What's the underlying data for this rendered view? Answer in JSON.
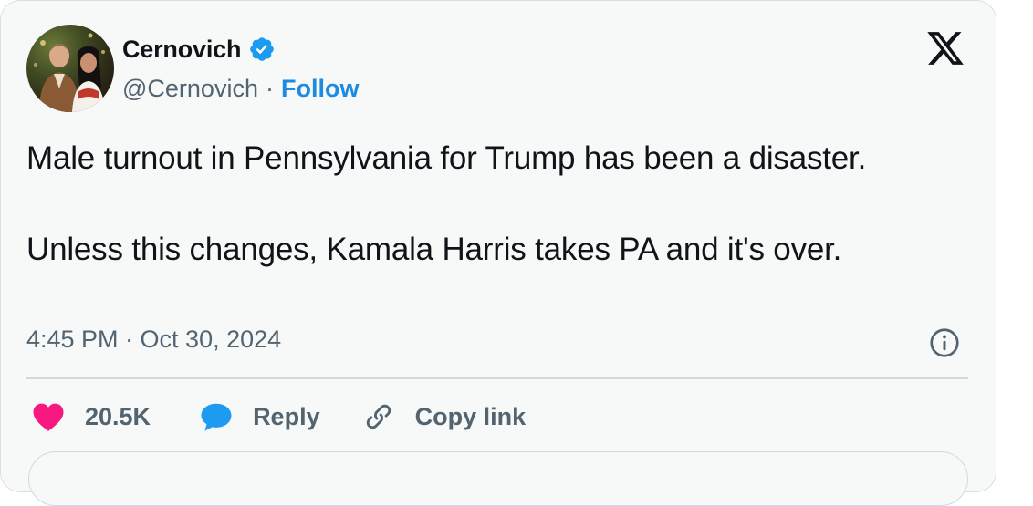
{
  "tweet": {
    "display_name": "Cernovich",
    "handle": "@Cernovich",
    "separator": "·",
    "follow_label": "Follow",
    "paragraphs": [
      "Male turnout in Pennsylvania for Trump has been a disaster.",
      "Unless this changes, Kamala Harris takes PA and it's over."
    ],
    "timestamp": "4:45 PM · Oct 30, 2024",
    "icons": {
      "brand": "x-logo-icon",
      "verified": "verified-badge-icon",
      "info": "info-icon",
      "like": "heart-icon",
      "reply": "speech-bubble-icon",
      "copy": "link-icon"
    }
  },
  "actions": {
    "like_count": "20.5K",
    "reply_label": "Reply",
    "copy_label": "Copy link"
  },
  "colors": {
    "accent": "#1d8be0",
    "like": "#f91880",
    "reply": "#1d9bf0",
    "text": "#0f1419",
    "muted": "#536471",
    "card_background": "#f7f9f9"
  }
}
